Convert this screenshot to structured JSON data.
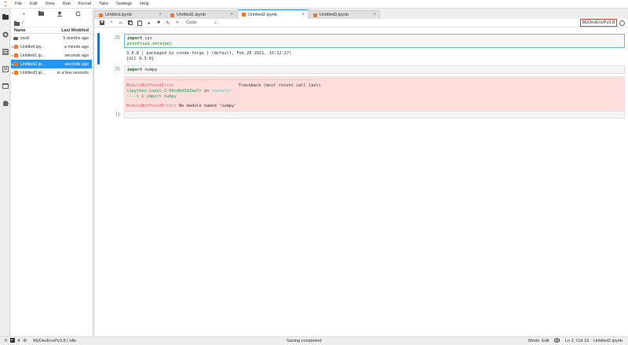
{
  "menu": [
    "File",
    "Edit",
    "View",
    "Run",
    "Kernel",
    "Tabs",
    "Settings",
    "Help"
  ],
  "filebrowser": {
    "breadcrumb": "/",
    "col_name": "Name",
    "col_modified": "Last Modified",
    "items": [
      {
        "name": "work",
        "modified": "5 months ago",
        "type": "folder"
      },
      {
        "name": "Untitled.ipy...",
        "modified": "a minute ago",
        "type": "notebook"
      },
      {
        "name": "Untitled1.ip...",
        "modified": "seconds ago",
        "type": "notebook"
      },
      {
        "name": "Untitled2.ip...",
        "modified": "seconds ago",
        "type": "notebook",
        "selected": true
      },
      {
        "name": "Untitled3.ip...",
        "modified": "in a few seconds",
        "type": "notebook"
      }
    ]
  },
  "tabs": [
    {
      "label": "Untitled.ipynb"
    },
    {
      "label": "Untitled1.ipynb"
    },
    {
      "label": "Untitled2.ipynb",
      "active": true
    },
    {
      "label": "Untitled3.ipynb"
    }
  ],
  "toolbar": {
    "cell_type": "Code",
    "kernel_name": "MyDevEnvPy3.8"
  },
  "cells": [
    {
      "prompt": "[1]:",
      "code_line1_kw": "import",
      "code_line1_rest": " sys",
      "code_line2": "print(sys.version)",
      "output_line1": "3.8.8 | packaged by conda-forge | (default, Feb 20 2021, 16:22:27)",
      "output_line2": "[GCC 9.3.0]"
    },
    {
      "prompt": "[1]:",
      "code_kw": "import",
      "code_rest": " numpy",
      "err_dashes": "---------------------------------------------------------------------------",
      "err_name": "ModuleNotFoundError",
      "err_traceback": "Traceback (most recent call last)",
      "err_input": "<ipython-input-2-04cdbd5d2aa7>",
      "err_in": " in ",
      "err_module": "<module>",
      "err_arrow": "----> 1 import numpy",
      "err_final_name": "ModuleNotFoundError",
      "err_final_msg": ": No module named 'numpy'"
    },
    {
      "prompt": "[ ]:"
    }
  ],
  "statusbar": {
    "left_num": "0",
    "terminals": "4",
    "kernel_status": "MyDevEnvPy3.8 | Idle",
    "center": "Saving completed",
    "mode": "Mode: Edit",
    "position": "Ln 2, Col 19",
    "file": "Untitled2.ipynb"
  },
  "colors": {
    "accent": "#2196f3",
    "brand": "#f37626",
    "kernel_outline": "#e53935",
    "error_bg": "#ffdddd"
  }
}
